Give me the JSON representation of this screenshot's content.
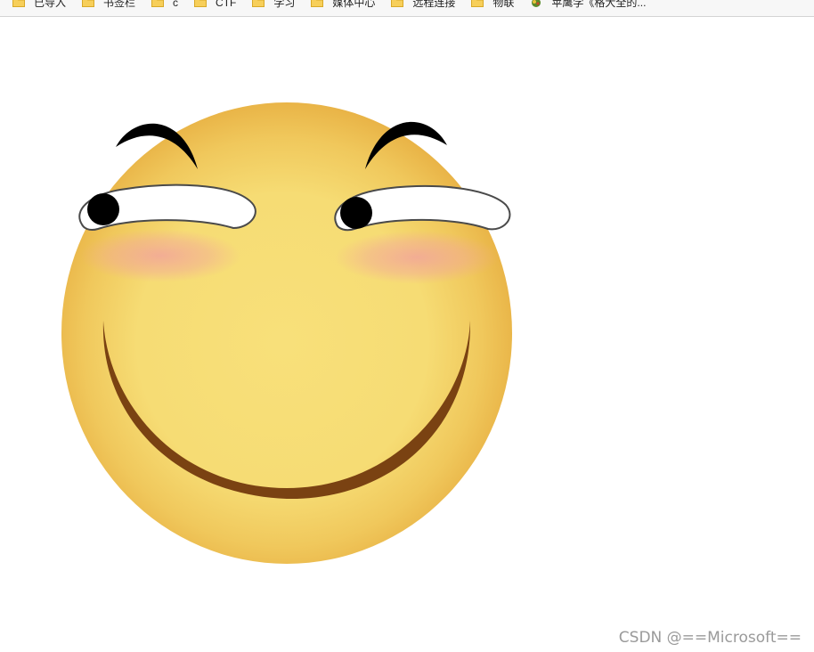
{
  "bookmarks": [
    {
      "label": "已导入",
      "icon": "folder-icon"
    },
    {
      "label": "书签栏",
      "icon": "folder-icon"
    },
    {
      "label": "c",
      "icon": "folder-icon"
    },
    {
      "label": "CTF",
      "icon": "folder-icon"
    },
    {
      "label": "学习",
      "icon": "folder-icon"
    },
    {
      "label": "媒体中心",
      "icon": "folder-icon"
    },
    {
      "label": "远程连接",
      "icon": "folder-icon"
    },
    {
      "label": "物联",
      "icon": "folder-icon"
    },
    {
      "label": "苹鹰学《格大全的...",
      "icon": "site-favicon-icon"
    }
  ],
  "colors": {
    "face_light": "#f8e07a",
    "face_dark": "#e9b447",
    "blush": "#f2a59a",
    "mouth": "#7a4212",
    "eyebrow": "#000000",
    "eye_white": "#ffffff",
    "pupil": "#000000"
  },
  "watermark": "CSDN @==Microsoft=="
}
